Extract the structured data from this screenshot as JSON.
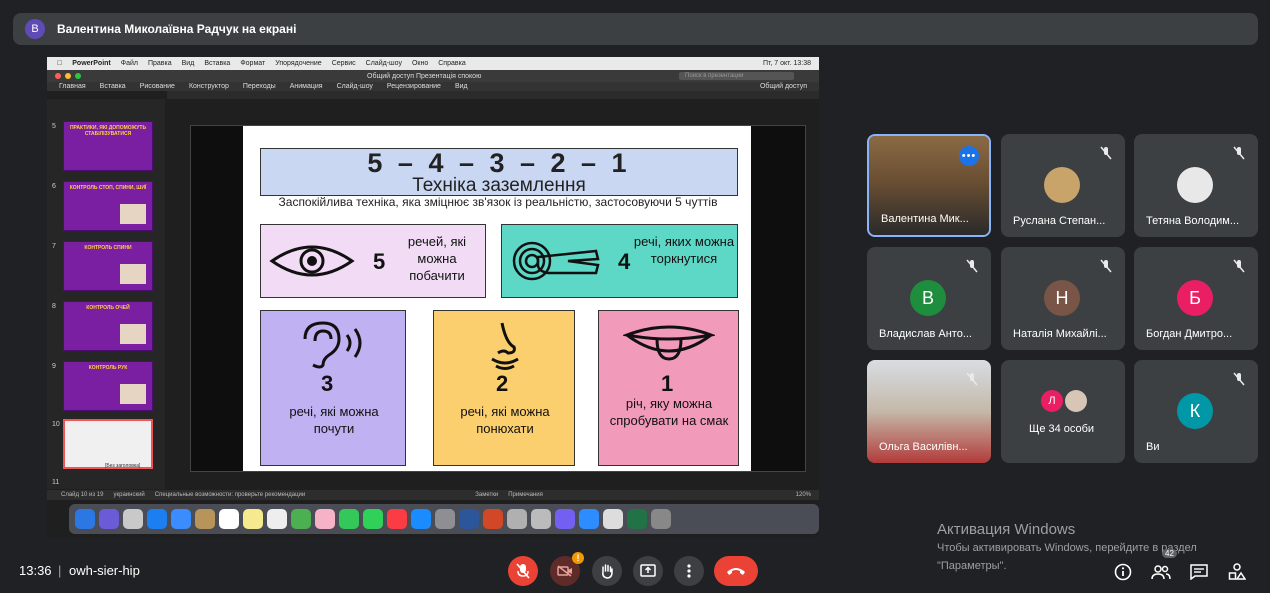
{
  "presenter_banner": {
    "avatar_letter": "В",
    "text": "Валентина Миколаївна Радчук на екрані"
  },
  "shared_screen": {
    "mac_menu": [
      "PowerPoint",
      "Файл",
      "Правка",
      "Вид",
      "Вставка",
      "Формат",
      "Упорядочение",
      "Сервис",
      "Слайд-шоу",
      "Окно",
      "Справка"
    ],
    "clock": "Пт, 7 окт. 13:38",
    "window_title": "Общий доступ Презентація спокою",
    "search_placeholder": "Поиск в презентации",
    "ribbon_tabs": [
      "Главная",
      "Вставка",
      "Рисование",
      "Конструктор",
      "Переходы",
      "Анимация",
      "Слайд-шоу",
      "Рецензирование",
      "Вид"
    ],
    "share_label": "Общий доступ",
    "thumbnails": [
      {
        "num": "5",
        "title": "ПРАКТИКИ, ЯКІ ДОПОМОЖУТЬ СТАБІЛІЗУВАТИСЯ"
      },
      {
        "num": "6",
        "title": "КОНТРОЛЬ СТОП, СПИНИ, ШИЇ"
      },
      {
        "num": "7",
        "title": "КОНТРОЛЬ СПИНИ"
      },
      {
        "num": "8",
        "title": "КОНТРОЛЬ ОЧЕЙ"
      },
      {
        "num": "9",
        "title": "КОНТРОЛЬ РУК"
      },
      {
        "num": "10",
        "title": "[Без заголовка]"
      },
      {
        "num": "11",
        "title": ""
      }
    ],
    "slide": {
      "heading_numbers": "5 – 4 – 3 – 2 – 1",
      "heading_title": "Техніка заземлення",
      "subtitle": "Заспокійлива техніка, яка зміцнює зв'язок із реальністю, застосовуючи 5 чуттів",
      "box5": {
        "num": "5",
        "text": "речей, які можна побачити"
      },
      "box4": {
        "num": "4",
        "text": "речі, яких можна торкнутися"
      },
      "box3": {
        "num": "3",
        "text": "речі, які можна почути"
      },
      "box2": {
        "num": "2",
        "text": "речі, які можна понюхати"
      },
      "box1": {
        "num": "1",
        "text": "річ, яку можна спробувати на смак"
      }
    },
    "status": {
      "slide": "Слайд 10 из 19",
      "lang": "украинский",
      "accessibility": "Специальные возможности: проверьте рекомендации",
      "notes": "Заметки",
      "comments": "Примечания",
      "zoom": "120%"
    }
  },
  "participants": [
    {
      "name": "Валентина Мик...",
      "type": "video",
      "active": true
    },
    {
      "name": "Руслана Степан...",
      "type": "photo",
      "muted": true
    },
    {
      "name": "Тетяна Володим...",
      "type": "photo",
      "muted": true
    },
    {
      "name": "Владислав Анто...",
      "letter": "В",
      "color": "#1e8e3e",
      "muted": true
    },
    {
      "name": "Наталія Михайлі...",
      "letter": "Н",
      "color": "#795548",
      "muted": true
    },
    {
      "name": "Богдан Дмитро...",
      "letter": "Б",
      "color": "#e91e63",
      "muted": true
    },
    {
      "name": "Ольга Василівн...",
      "type": "video",
      "muted": true
    },
    {
      "name": "Ще 34 особи",
      "letter": "Л",
      "color": "#e91e63"
    },
    {
      "name": "Ви",
      "letter": "К",
      "color": "#0097a7",
      "muted": true
    }
  ],
  "windows_activation": {
    "title": "Активация Windows",
    "line1": "Чтобы активировать Windows, перейдите в раздел",
    "line2": "\"Параметры\"."
  },
  "bottom": {
    "time": "13:36",
    "separator": "|",
    "meeting_code": "owh-sier-hip",
    "participant_count": "42",
    "camera_badge": "!"
  },
  "colors": {
    "accent": "#8ab4f8",
    "danger": "#ea4335",
    "background": "#202124"
  }
}
